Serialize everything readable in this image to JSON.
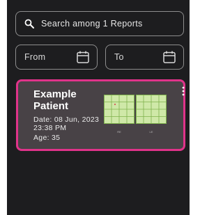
{
  "search": {
    "placeholder": "Search among 1 Reports"
  },
  "filters": {
    "from_label": "From",
    "to_label": "To"
  },
  "report": {
    "name": "Example Patient",
    "date": "Date: 08 Jun, 2023 23:38 PM",
    "age": "Age: 35",
    "thumbnail_captions": [
      "RE",
      "LE"
    ]
  },
  "colors": {
    "background": "#1d1d1f",
    "card": "#484246",
    "card_border": "#e0338a",
    "grid_fill": "#cfe8a8",
    "grid_line": "#7fb24d"
  }
}
